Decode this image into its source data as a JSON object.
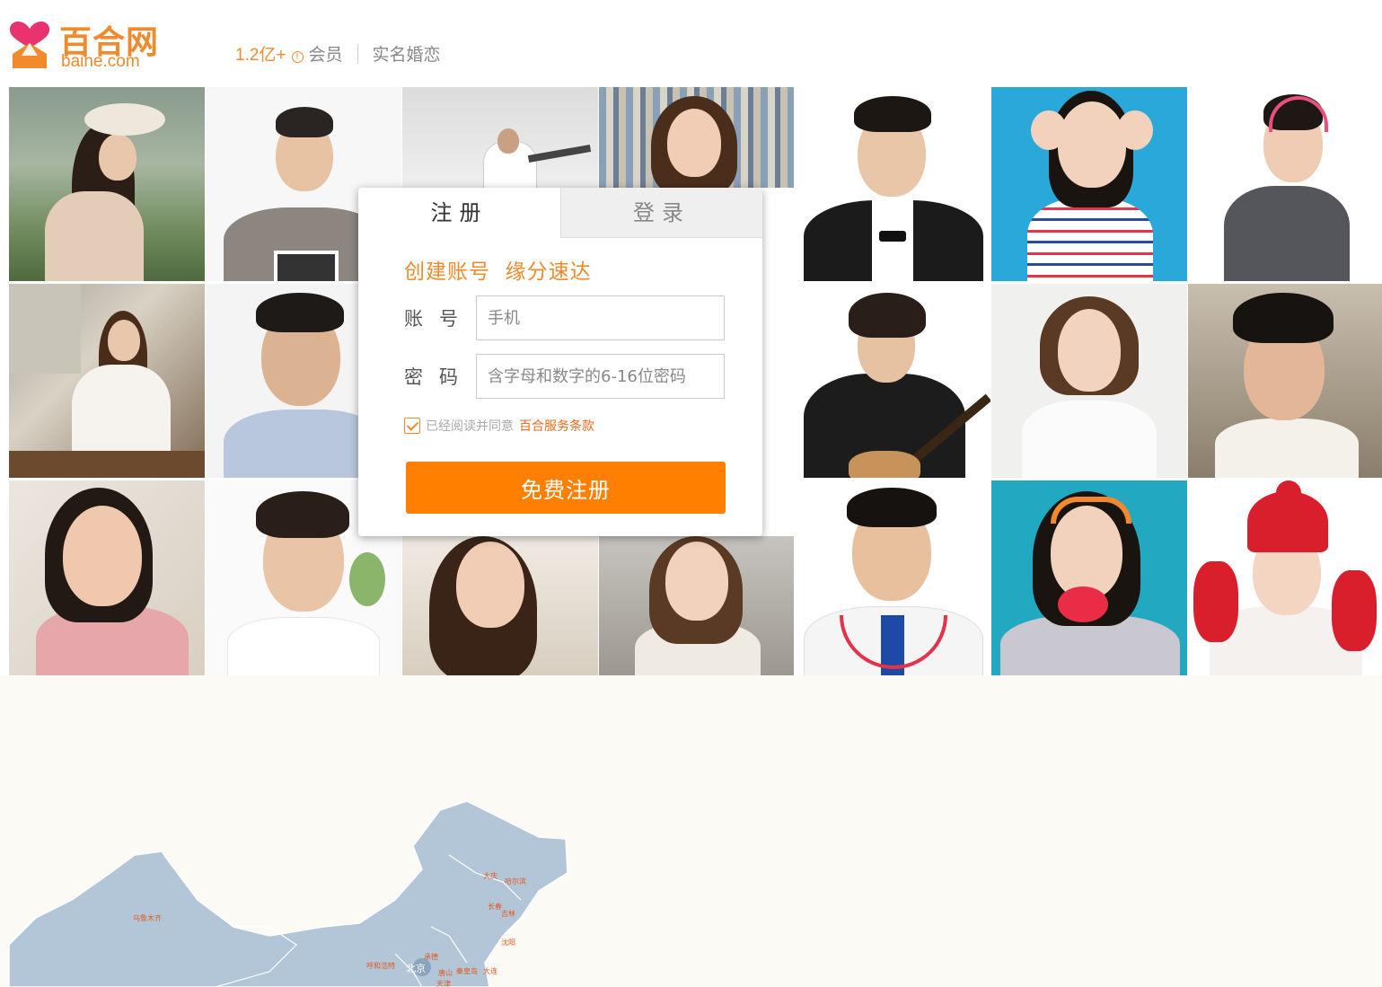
{
  "brand": {
    "name_cn": "百合网",
    "name_en": "baihe.com",
    "colors": {
      "primary": "#f08a2c",
      "button": "#ff7f00",
      "logo_pink": "#e8336f"
    }
  },
  "header": {
    "member_count": "1.2亿+",
    "info_icon": "info-icon",
    "member_label": "会员",
    "tagline": "实名婚恋"
  },
  "form": {
    "tabs": [
      {
        "label": "注册",
        "active": true
      },
      {
        "label": "登录",
        "active": false
      }
    ],
    "slogan": "创建账号  缘分速达",
    "account_label": "账号",
    "account_placeholder": "手机",
    "password_label": "密码",
    "password_placeholder": "含字母和数字的6-16位密码",
    "agree_checked": true,
    "agree_text": "已经阅读并同意",
    "terms_link": "百合服务条款",
    "submit_label": "免费注册"
  },
  "photos": [
    "woman-in-sun-hat",
    "man-holding-chalkboard",
    "man-jumping",
    "woman-in-library",
    "man-in-tuxedo",
    "woman-ok-gesture",
    "woman-with-headphones",
    "woman-with-ukulele",
    "man-smiling-hand-on-chin",
    "man-playing-guitar",
    "woman-with-makeup-brush",
    "young-man-portrait",
    "woman-smiling",
    "man-smiling",
    "woman-side-profile",
    "woman-with-headphones-street",
    "doctor-with-stethoscope",
    "woman-with-heart-props",
    "woman-in-red-hat"
  ],
  "map": {
    "cities": [
      "乌鲁木齐",
      "大庆",
      "哈尔滨",
      "长春",
      "吉林",
      "沈阳",
      "呼和浩特",
      "北京",
      "承德",
      "唐山",
      "秦皇岛",
      "大连",
      "天津"
    ]
  }
}
